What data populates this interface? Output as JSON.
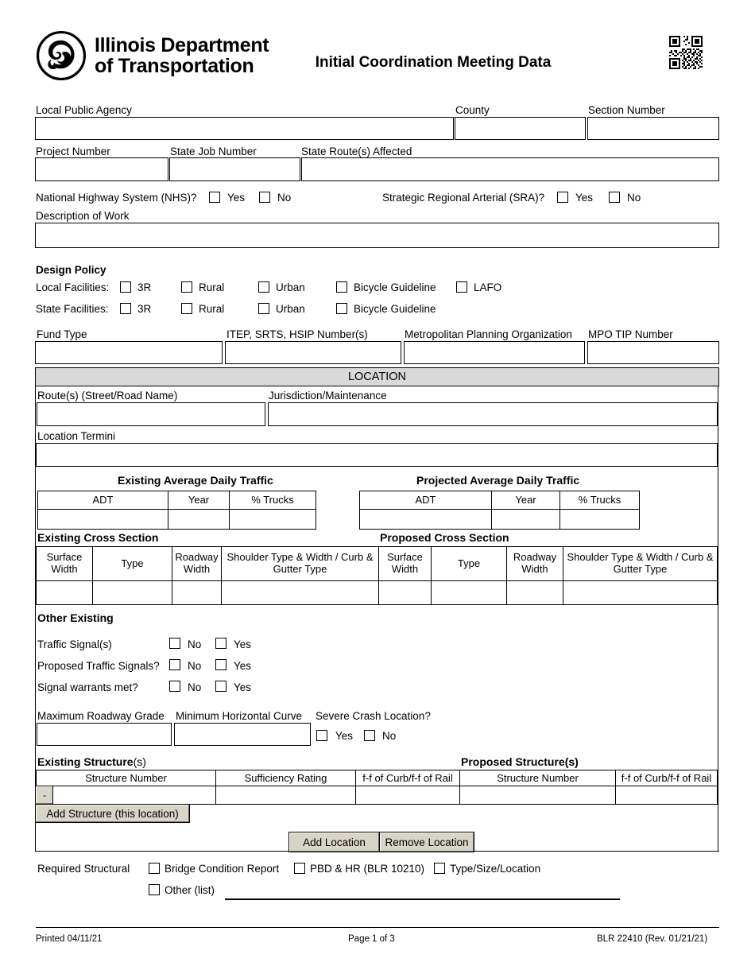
{
  "header": {
    "agency_line1": "Illinois Department",
    "agency_line2": "of Transportation",
    "title": "Initial Coordination Meeting Data",
    "qr_alt": "qr-code"
  },
  "row_agency": {
    "local_public_agency_label": "Local Public Agency",
    "local_public_agency_value": "",
    "county_label": "County",
    "county_value": "",
    "section_number_label": "Section Number",
    "section_number_value": ""
  },
  "row_project": {
    "project_number_label": "Project Number",
    "project_number_value": "",
    "state_job_number_label": "State Job Number",
    "state_job_number_value": "",
    "state_routes_label": "State Route(s) Affected",
    "state_routes_value": ""
  },
  "row_nhs": {
    "nhs_question": "National Highway System (NHS)?",
    "nhs_yes": "Yes",
    "nhs_no": "No",
    "sra_question": "Strategic Regional Arterial (SRA)?",
    "sra_yes": "Yes",
    "sra_no": "No"
  },
  "description": {
    "label": "Description of Work",
    "value": ""
  },
  "design_policy": {
    "heading": "Design Policy",
    "local_label": "Local Facilities:",
    "local_options": [
      "3R",
      "Rural",
      "Urban",
      "Bicycle Guideline",
      "LAFO"
    ],
    "state_label": "State Facilities:",
    "state_options": [
      "3R",
      "Rural",
      "Urban",
      "Bicycle Guideline"
    ]
  },
  "row_fund": {
    "fund_type_label": "Fund Type",
    "fund_type_value": "",
    "itep_label": "ITEP, SRTS, HSIP Number(s)",
    "itep_value": "",
    "mpo_label": "Metropolitan Planning Organization",
    "mpo_value": "",
    "mpo_tip_label": "MPO TIP Number",
    "mpo_tip_value": ""
  },
  "location": {
    "banner": "LOCATION",
    "routes_label": "Route(s) (Street/Road Name)",
    "routes_value": "",
    "jurisdiction_label": "Jurisdiction/Maintenance",
    "jurisdiction_value": "",
    "termini_label": "Location Termini",
    "termini_value": ""
  },
  "adt": {
    "existing_heading": "Existing Average Daily Traffic",
    "projected_heading": "Projected Average Daily Traffic",
    "columns": [
      "ADT",
      "Year",
      "% Trucks"
    ],
    "existing_values": [
      "",
      "",
      ""
    ],
    "projected_values": [
      "",
      "",
      ""
    ]
  },
  "cross_section": {
    "existing_heading": "Existing Cross Section",
    "proposed_heading": "Proposed Cross Section",
    "columns": [
      "Surface Width",
      "Type",
      "Roadway Width",
      "Shoulder Type & Width / Curb & Gutter Type"
    ],
    "existing_values": [
      "",
      "",
      "",
      ""
    ],
    "proposed_values": [
      "",
      "",
      "",
      ""
    ]
  },
  "other_existing": {
    "heading": "Other Existing",
    "rows": [
      {
        "label": "Traffic Signal(s)",
        "no": "No",
        "yes": "Yes"
      },
      {
        "label": "Proposed Traffic Signals?",
        "no": "No",
        "yes": "Yes"
      },
      {
        "label": "Signal warrants met?",
        "no": "No",
        "yes": "Yes"
      }
    ],
    "max_grade_label": "Maximum Roadway Grade",
    "max_grade_value": "",
    "min_curve_label": "Minimum Horizontal Curve",
    "min_curve_value": "",
    "crash_label": "Severe Crash Location?",
    "crash_yes": "Yes",
    "crash_no": "No"
  },
  "structures": {
    "existing_heading_bold": "Existing Structure",
    "existing_heading_tail": "(s)",
    "proposed_heading": "Proposed Structure(s)",
    "columns": [
      "Structure Number",
      "Sufficiency Rating",
      "f-f of Curb/f-f of Rail",
      "Structure Number",
      "f-f of Curb/f-f of Rail"
    ],
    "remove_row_label": "-",
    "row_values": [
      "",
      "",
      "",
      "",
      ""
    ],
    "add_structure_label": "Add Structure (this location)",
    "add_location_label": "Add Location",
    "remove_location_label": "Remove Location"
  },
  "required_structural": {
    "label": "Required Structural",
    "options": [
      "Bridge Condition Report",
      "PBD & HR (BLR 10210)",
      "Type/Size/Location"
    ],
    "other_label": "Other (list)",
    "other_value": ""
  },
  "footer": {
    "printed": "Printed 04/11/21",
    "page": "Page 1 of 3",
    "form_id": "BLR 22410 (Rev. 01/21/21)"
  }
}
